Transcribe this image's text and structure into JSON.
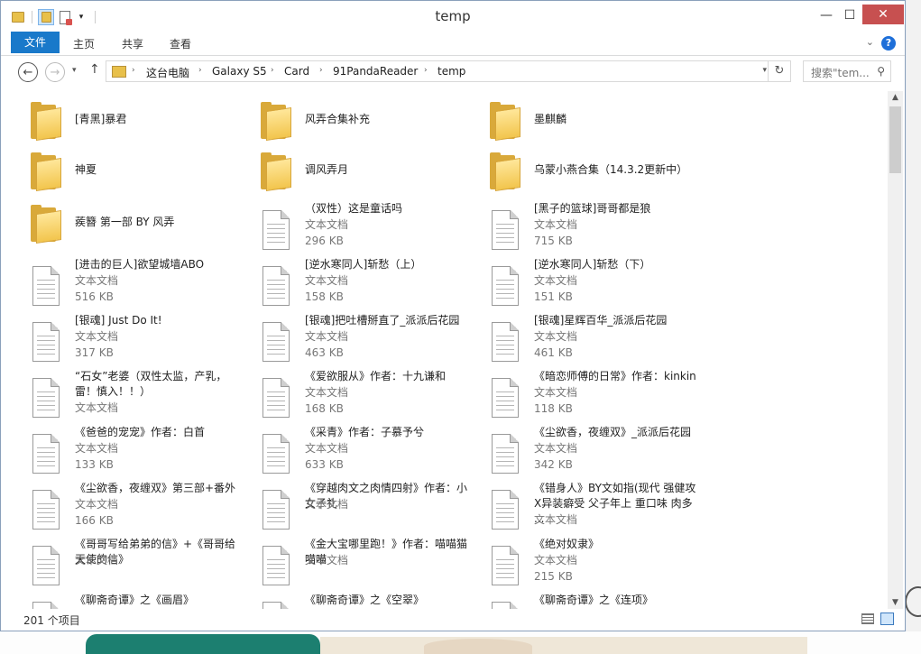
{
  "window": {
    "title": "temp"
  },
  "ribbon": {
    "tabs": [
      "文件",
      "主页",
      "共享",
      "查看"
    ]
  },
  "address": {
    "crumbs": [
      "这台电脑",
      "Galaxy S5",
      "Card",
      "91PandaReader",
      "temp"
    ],
    "search_placeholder": "搜索\"tem..."
  },
  "items": [
    {
      "type": "folder",
      "name": "[青黑]暴君"
    },
    {
      "type": "folder",
      "name": "风弄合集补充"
    },
    {
      "type": "folder",
      "name": "墨麒麟"
    },
    {
      "type": "folder",
      "name": "神夏"
    },
    {
      "type": "folder",
      "name": "调风弄月"
    },
    {
      "type": "folder",
      "name": "乌蒙小燕合集（14.3.2更新中）"
    },
    {
      "type": "folder",
      "name": "蒺簪 第一部 BY 风弄"
    },
    {
      "type": "doc",
      "name": "（双性）这是童话吗",
      "kind": "文本文档",
      "size": "296 KB"
    },
    {
      "type": "doc",
      "name": "[黑子的篮球]哥哥都是狼",
      "kind": "文本文档",
      "size": "715 KB"
    },
    {
      "type": "doc",
      "name": "[进击的巨人]欲望城墙ABO",
      "kind": "文本文档",
      "size": "516 KB"
    },
    {
      "type": "doc",
      "name": "[逆水寒同人]斩愁（上）",
      "kind": "文本文档",
      "size": "158 KB"
    },
    {
      "type": "doc",
      "name": "[逆水寒同人]斩愁（下）",
      "kind": "文本文档",
      "size": "151 KB"
    },
    {
      "type": "doc",
      "name": "[银魂] Just Do It!",
      "kind": "文本文档",
      "size": "317 KB"
    },
    {
      "type": "doc",
      "name": "[银魂]把吐槽掰直了_派派后花园",
      "kind": "文本文档",
      "size": "463 KB"
    },
    {
      "type": "doc",
      "name": "[银魂]星辉百华_派派后花园",
      "kind": "文本文档",
      "size": "461 KB"
    },
    {
      "type": "doc",
      "name": "“石女”老婆（双性太监，产乳，雷！慎入！！）",
      "kind": "文本文档",
      "size": ""
    },
    {
      "type": "doc",
      "name": "《爱欲服从》作者：十九谦和",
      "kind": "文本文档",
      "size": "168 KB"
    },
    {
      "type": "doc",
      "name": "《暗恋师傅的日常》作者：kinkin",
      "kind": "文本文档",
      "size": "118 KB"
    },
    {
      "type": "doc",
      "name": "《爸爸的宠宠》作者：白首",
      "kind": "文本文档",
      "size": "133 KB"
    },
    {
      "type": "doc",
      "name": "《采青》作者：子慕予兮",
      "kind": "文本文档",
      "size": "633 KB"
    },
    {
      "type": "doc",
      "name": "《尘欲香，夜缠双》_派派后花园",
      "kind": "文本文档",
      "size": "342 KB"
    },
    {
      "type": "doc",
      "name": "《尘欲香，夜缠双》第三部+番外",
      "kind": "文本文档",
      "size": "166 KB"
    },
    {
      "type": "doc",
      "name": "《穿越肉文之肉情四射》作者：小女子礼",
      "kind": "文本文档",
      "size": ""
    },
    {
      "type": "doc",
      "name": "《错身人》BY文如指(现代 强健攻X异装癖受 父子年上 重口味 肉多 ...",
      "kind": "文本文档",
      "size": ""
    },
    {
      "type": "doc",
      "name": "《哥哥写给弟弟的信》+《哥哥给天使的信》",
      "kind": "文本文档",
      "size": ""
    },
    {
      "type": "doc",
      "name": "《金大宝哪里跑！》作者：喵喵猫喵喵",
      "kind": "文本文档",
      "size": ""
    },
    {
      "type": "doc",
      "name": "《绝对奴隶》",
      "kind": "文本文档",
      "size": "215 KB"
    },
    {
      "type": "doc",
      "name": "《聊斋奇谭》之《画眉》",
      "kind": "",
      "size": ""
    },
    {
      "type": "doc",
      "name": "《聊斋奇谭》之《空翠》",
      "kind": "",
      "size": ""
    },
    {
      "type": "doc",
      "name": "《聊斋奇谭》之《连项》",
      "kind": "",
      "size": ""
    }
  ],
  "status": {
    "count_text": "201 个项目"
  },
  "glyphs": {
    "back": "←",
    "forward": "→",
    "up": "↑",
    "chevron": "▾",
    "sep": "›",
    "refresh": "↻",
    "search": "⚲",
    "minimize": "—",
    "maximize": "☐",
    "close": "✕",
    "help": "?",
    "ribbon_caret": "⌄",
    "scroll_up": "▲",
    "scroll_down": "▼"
  }
}
